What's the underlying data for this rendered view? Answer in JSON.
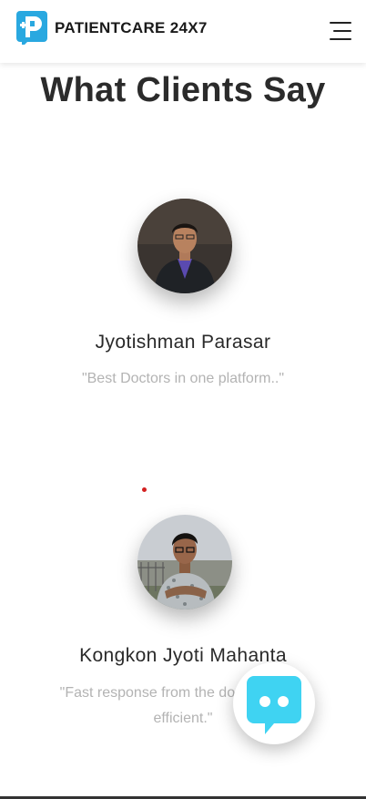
{
  "header": {
    "brand": "PATIENTCARE 24X7",
    "logo_icon": "patientcare-logo-icon",
    "menu_icon": "hamburger-menu-icon"
  },
  "section": {
    "title": "What Clients Say"
  },
  "testimonials": [
    {
      "name": "Jyotishman Parasar",
      "quote": "\"Best Doctors in one platform..\"",
      "avatar_icon": "person-avatar"
    },
    {
      "name": "Kongkon Jyoti Mahanta",
      "quote": "\"Fast response from the doctors. Most efficient.\"",
      "avatar_icon": "person-avatar"
    }
  ],
  "chat_widget": {
    "icon": "chatbot-icon",
    "accent_color": "#3fd3f2"
  },
  "colors": {
    "brand_blue": "#29a8e0",
    "quote_gray": "#b3b3b3",
    "title_dark": "#2b2b2b"
  }
}
